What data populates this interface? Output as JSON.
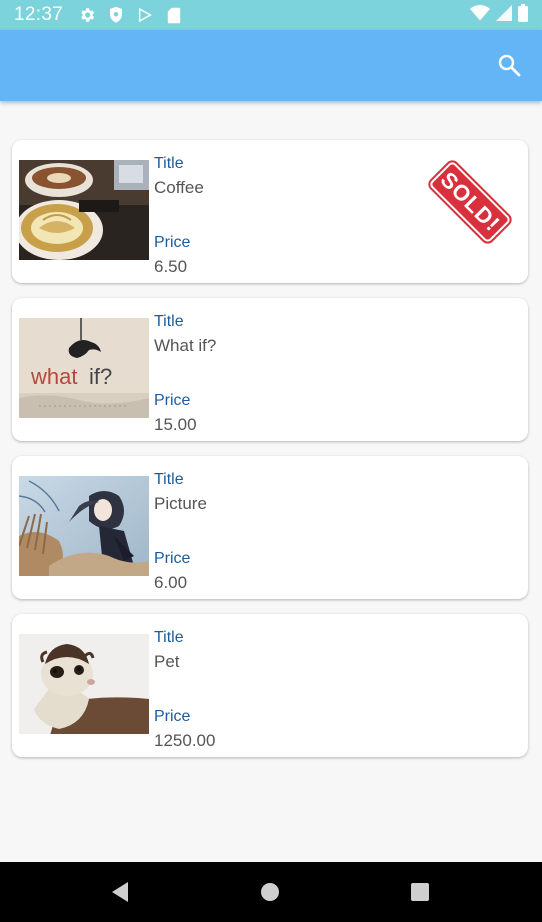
{
  "status_bar": {
    "time": "12:37",
    "left_icons": [
      "gear-icon",
      "shield-icon",
      "play-store-icon",
      "sd-card-icon"
    ],
    "right_icons": [
      "wifi-icon",
      "signal-icon",
      "battery-icon"
    ]
  },
  "app_bar": {
    "background": "#64b5f6",
    "actions": [
      "search-icon"
    ]
  },
  "items": [
    {
      "title_label": "Title",
      "title": "Coffee",
      "price_label": "Price",
      "price": "6.50",
      "image": "coffee latte art photo",
      "badge": "SOLD!"
    },
    {
      "title_label": "Title",
      "title": "What if?",
      "price_label": "Price",
      "price": "15.00",
      "image": "what if sign photo"
    },
    {
      "title_label": "Title",
      "title": "Picture",
      "price_label": "Price",
      "price": "6.00",
      "image": "anime girl illustration"
    },
    {
      "title_label": "Title",
      "title": "Pet",
      "price_label": "Price",
      "price": "1250.00",
      "image": "ferret photo"
    }
  ],
  "colors": {
    "status_bar": "#7dd3dc",
    "label": "#1c5c9e",
    "value": "#555555",
    "sold_badge": "#d9303d",
    "nav_bar": "#000000"
  },
  "nav_bar": {
    "buttons": [
      "back-icon",
      "home-icon",
      "recents-icon"
    ]
  }
}
